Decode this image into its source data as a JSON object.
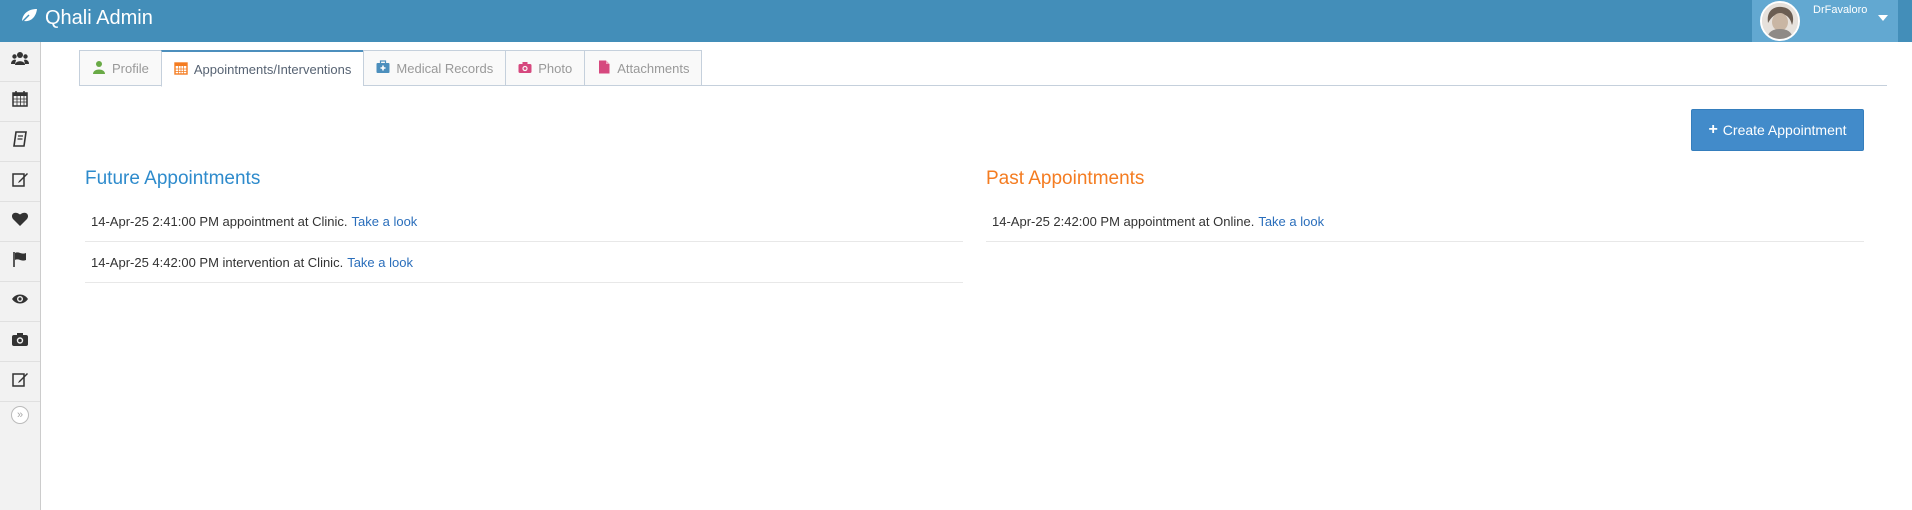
{
  "app": {
    "title": "Qhali Admin"
  },
  "user": {
    "name": "DrFavaloro"
  },
  "sidebar": {
    "items": [
      {
        "icon": "users-icon"
      },
      {
        "icon": "calendar-icon"
      },
      {
        "icon": "book-icon"
      },
      {
        "icon": "edit-icon"
      },
      {
        "icon": "heart-icon"
      },
      {
        "icon": "flag-icon"
      },
      {
        "icon": "eye-icon"
      },
      {
        "icon": "camera-icon"
      },
      {
        "icon": "edit-icon"
      }
    ],
    "collapse_glyph": "»"
  },
  "tabs": [
    {
      "label": "Profile",
      "icon": "user-icon",
      "color": "#69aa46"
    },
    {
      "label": "Appointments/Interventions",
      "icon": "calendar-icon",
      "color": "#f47c21",
      "active": true
    },
    {
      "label": "Medical Records",
      "icon": "medkit-icon",
      "color": "#4c8fbd"
    },
    {
      "label": "Photo",
      "icon": "camera-icon",
      "color": "#d6487e"
    },
    {
      "label": "Attachments",
      "icon": "file-icon",
      "color": "#d6487e"
    }
  ],
  "actions": {
    "create_label": "Create Appointment"
  },
  "future": {
    "title": "Future Appointments",
    "items": [
      {
        "text": "14-Apr-25 2:41:00 PM appointment at Clinic.",
        "link": "Take a look"
      },
      {
        "text": "14-Apr-25 4:42:00 PM intervention at Clinic.",
        "link": "Take a look"
      }
    ]
  },
  "past": {
    "title": "Past Appointments",
    "items": [
      {
        "text": "14-Apr-25 2:42:00 PM appointment at Online.",
        "link": "Take a look"
      }
    ]
  },
  "colors": {
    "navbar": "#438eb9",
    "accent_blue": "#2e8bcc",
    "accent_orange": "#f47c21",
    "button": "#428bca",
    "link": "#2a6ebb"
  }
}
